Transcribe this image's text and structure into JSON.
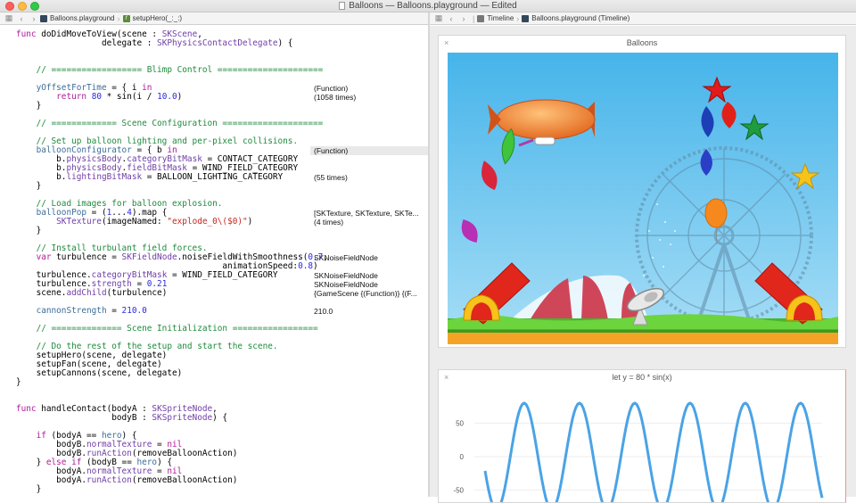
{
  "window": {
    "title": "Balloons — Balloons.playground — Edited"
  },
  "editor_jumpbar": {
    "file": "Balloons.playground",
    "function": "setupHero(_:_:)"
  },
  "timeline_jumpbar": {
    "section": "Timeline",
    "file": "Balloons.playground (Timeline)"
  },
  "code_lines": [
    [
      [
        "func ",
        "kw"
      ],
      [
        "doDidMoveToView(scene : ",
        ""
      ],
      [
        "SKScene",
        "ty"
      ],
      [
        ",",
        ""
      ]
    ],
    [
      [
        "                 delegate : ",
        ""
      ],
      [
        "SKPhysicsContactDelegate",
        "ty"
      ],
      [
        ") {",
        ""
      ]
    ],
    [
      [
        "",
        ""
      ]
    ],
    [
      [
        "",
        ""
      ]
    ],
    [
      [
        "    // ================== Blimp Control =====================",
        "cm"
      ]
    ],
    [
      [
        "",
        ""
      ]
    ],
    [
      [
        "    ",
        ""
      ],
      [
        "yOffsetForTime",
        "prj"
      ],
      [
        " = { i ",
        ""
      ],
      [
        "in",
        "kw"
      ]
    ],
    [
      [
        "        ",
        ""
      ],
      [
        "return",
        "kw"
      ],
      [
        " ",
        ""
      ],
      [
        "80",
        "nm"
      ],
      [
        " * sin(i / ",
        ""
      ],
      [
        "10.0",
        "nm"
      ],
      [
        ")",
        ""
      ]
    ],
    [
      [
        "    }",
        ""
      ]
    ],
    [
      [
        "",
        ""
      ]
    ],
    [
      [
        "    // ============= Scene Configuration ====================",
        "cm"
      ]
    ],
    [
      [
        "",
        ""
      ]
    ],
    [
      [
        "    // Set up balloon lighting and per-pixel collisions.",
        "cm"
      ]
    ],
    [
      [
        "    ",
        ""
      ],
      [
        "balloonConfigurator",
        "prj"
      ],
      [
        " = { b ",
        ""
      ],
      [
        "in",
        "kw"
      ]
    ],
    [
      [
        "        b.",
        ""
      ],
      [
        "physicsBody",
        "ty"
      ],
      [
        ".",
        ""
      ],
      [
        "categoryBitMask",
        "ty"
      ],
      [
        " = CONTACT_CATEGORY",
        ""
      ]
    ],
    [
      [
        "        b.",
        ""
      ],
      [
        "physicsBody",
        "ty"
      ],
      [
        ".",
        ""
      ],
      [
        "fieldBitMask",
        "ty"
      ],
      [
        " = WIND_FIELD_CATEGORY",
        ""
      ]
    ],
    [
      [
        "        b.",
        ""
      ],
      [
        "lightingBitMask",
        "ty"
      ],
      [
        " = BALLOON_LIGHTING_CATEGORY",
        ""
      ]
    ],
    [
      [
        "    }",
        ""
      ]
    ],
    [
      [
        "",
        ""
      ]
    ],
    [
      [
        "    // Load images for balloon explosion.",
        "cm"
      ]
    ],
    [
      [
        "    ",
        ""
      ],
      [
        "balloonPop",
        "prj"
      ],
      [
        " = (",
        ""
      ],
      [
        "1",
        "nm"
      ],
      [
        "...",
        ""
      ],
      [
        "4",
        "nm"
      ],
      [
        ").map {",
        ""
      ]
    ],
    [
      [
        "        ",
        ""
      ],
      [
        "SKTexture",
        "ty"
      ],
      [
        "(imageNamed: ",
        ""
      ],
      [
        "\"explode_0\\($0)\"",
        "st"
      ],
      [
        ")",
        ""
      ]
    ],
    [
      [
        "    }",
        ""
      ]
    ],
    [
      [
        "",
        ""
      ]
    ],
    [
      [
        "    // Install turbulant field forces.",
        "cm"
      ]
    ],
    [
      [
        "    ",
        ""
      ],
      [
        "var",
        "kw"
      ],
      [
        " turbulence = ",
        ""
      ],
      [
        "SKFieldNode",
        "ty"
      ],
      [
        ".noiseFieldWithSmoothness(",
        ""
      ],
      [
        "0.7",
        "nm"
      ],
      [
        ",",
        ""
      ]
    ],
    [
      [
        "                                         animationSpeed:",
        ""
      ],
      [
        "0.8",
        "nm"
      ],
      [
        ")",
        ""
      ]
    ],
    [
      [
        "    turbulence.",
        ""
      ],
      [
        "categoryBitMask",
        "ty"
      ],
      [
        " = WIND_FIELD_CATEGORY",
        ""
      ]
    ],
    [
      [
        "    turbulence.",
        ""
      ],
      [
        "strength",
        "ty"
      ],
      [
        " = ",
        ""
      ],
      [
        "0.21",
        "nm"
      ]
    ],
    [
      [
        "    scene.",
        ""
      ],
      [
        "addChild",
        "ty"
      ],
      [
        "(turbulence)",
        ""
      ]
    ],
    [
      [
        "",
        ""
      ]
    ],
    [
      [
        "    ",
        ""
      ],
      [
        "cannonStrength",
        "prj"
      ],
      [
        " = ",
        ""
      ],
      [
        "210.0",
        "nm"
      ]
    ],
    [
      [
        "",
        ""
      ]
    ],
    [
      [
        "    // ============== Scene Initialization =================",
        "cm"
      ]
    ],
    [
      [
        "",
        ""
      ]
    ],
    [
      [
        "    // Do the rest of the setup and start the scene.",
        "cm"
      ]
    ],
    [
      [
        "    setupHero(scene, delegate)",
        ""
      ]
    ],
    [
      [
        "    setupFan(scene, delegate)",
        ""
      ]
    ],
    [
      [
        "    setupCannons(scene, delegate)",
        ""
      ]
    ],
    [
      [
        "}",
        ""
      ]
    ],
    [
      [
        "",
        ""
      ]
    ],
    [
      [
        "",
        ""
      ]
    ],
    [
      [
        "func ",
        "kw"
      ],
      [
        "handleContact(bodyA : ",
        ""
      ],
      [
        "SKSpriteNode",
        "ty"
      ],
      [
        ",",
        ""
      ]
    ],
    [
      [
        "                   bodyB : ",
        ""
      ],
      [
        "SKSpriteNode",
        "ty"
      ],
      [
        ") {",
        ""
      ]
    ],
    [
      [
        "",
        ""
      ]
    ],
    [
      [
        "    ",
        ""
      ],
      [
        "if",
        "kw"
      ],
      [
        " (bodyA == ",
        ""
      ],
      [
        "hero",
        "prj"
      ],
      [
        ") {",
        ""
      ]
    ],
    [
      [
        "        bodyB.",
        ""
      ],
      [
        "normalTexture",
        "ty"
      ],
      [
        " = ",
        ""
      ],
      [
        "nil",
        "kw"
      ]
    ],
    [
      [
        "        bodyB.",
        ""
      ],
      [
        "runAction",
        "ty"
      ],
      [
        "(removeBalloonAction)",
        ""
      ]
    ],
    [
      [
        "    } ",
        ""
      ],
      [
        "else if",
        "kw"
      ],
      [
        " (bodyB == ",
        ""
      ],
      [
        "hero",
        "prj"
      ],
      [
        ") {",
        ""
      ]
    ],
    [
      [
        "        bodyA.",
        ""
      ],
      [
        "normalTexture",
        "ty"
      ],
      [
        " = ",
        ""
      ],
      [
        "nil",
        "kw"
      ]
    ],
    [
      [
        "        bodyA.",
        ""
      ],
      [
        "runAction",
        "ty"
      ],
      [
        "(removeBalloonAction)",
        ""
      ]
    ],
    [
      [
        "    }",
        ""
      ]
    ]
  ],
  "results": [
    {
      "line": 6,
      "text": "(Function)"
    },
    {
      "line": 7,
      "text": "(1058 times)"
    },
    {
      "line": 13,
      "text": "(Function)",
      "highlight": true
    },
    {
      "line": 16,
      "text": "(55 times)"
    },
    {
      "line": 20,
      "text": "[SKTexture, SKTexture, SKTe..."
    },
    {
      "line": 21,
      "text": "(4 times)"
    },
    {
      "line": 25,
      "text": "SKNoiseFieldNode"
    },
    {
      "line": 27,
      "text": "SKNoiseFieldNode"
    },
    {
      "line": 28,
      "text": "SKNoiseFieldNode"
    },
    {
      "line": 29,
      "text": "{GameScene {(Function)} {(F..."
    },
    {
      "line": 31,
      "text": "210.0"
    }
  ],
  "scene_panel": {
    "title": "Balloons",
    "close": "×"
  },
  "graph_panel": {
    "title": "let y = 80 * sin(x)",
    "close": "×"
  },
  "chart_data": {
    "type": "line",
    "title": "let y = 80 * sin(x)",
    "y_ticks": [
      "50",
      "0",
      "-50"
    ],
    "amplitude": 80,
    "function": "y = 80 * sin(x)",
    "visible_peaks": 5
  },
  "colors": {
    "sky": "#4fb8ea",
    "grass": "#47b62b",
    "line": "#4aa3e6",
    "blimp": "#f27e2a"
  }
}
